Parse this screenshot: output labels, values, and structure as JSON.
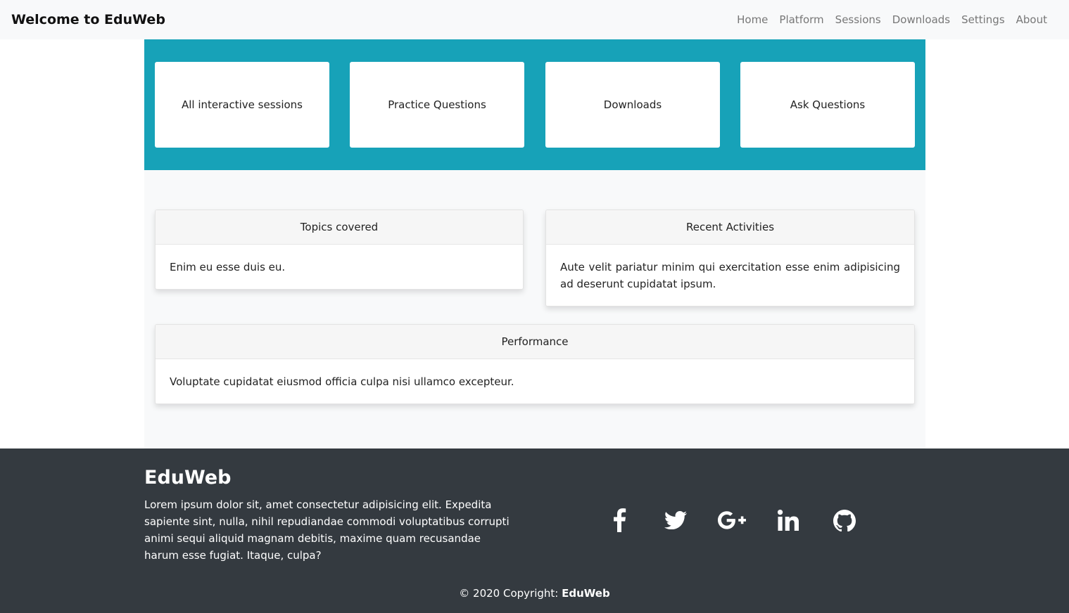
{
  "navbar": {
    "brand": "Welcome to EduWeb",
    "links": [
      "Home",
      "Platform",
      "Sessions",
      "Downloads",
      "Settings",
      "About"
    ]
  },
  "tiles": [
    "All interactive sessions",
    "Practice Questions",
    "Downloads",
    "Ask Questions"
  ],
  "cards": {
    "topics": {
      "title": "Topics covered",
      "body": "Enim eu esse duis eu."
    },
    "recent": {
      "title": "Recent Activities",
      "body": "Aute velit pariatur minim qui exercitation esse enim adipisicing ad deserunt cupidatat ipsum."
    },
    "performance": {
      "title": "Performance",
      "body": "Voluptate cupidatat eiusmod officia culpa nisi ullamco excepteur."
    }
  },
  "footer": {
    "title": "EduWeb",
    "text": "Lorem ipsum dolor sit, amet consectetur adipisicing elit. Expedita sapiente sint, nulla, nihil repudiandae commodi voluptatibus corrupti animi sequi aliquid magnam debitis, maxime quam recusandae harum esse fugiat. Itaque, culpa?",
    "socials": [
      "facebook-icon",
      "twitter-icon",
      "google-plus-icon",
      "linkedin-icon",
      "github-icon"
    ],
    "copyright_prefix": "© 2020 Copyright: ",
    "copyright_brand": "EduWeb"
  },
  "colors": {
    "banner": "#17a2b8",
    "footer": "#343a40",
    "navbar": "#f8f9fa"
  }
}
